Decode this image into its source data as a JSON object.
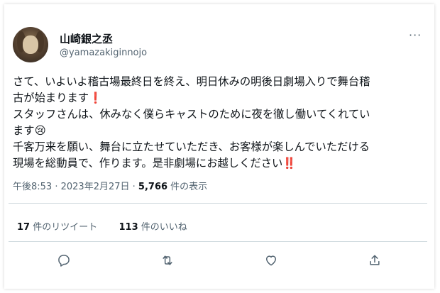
{
  "user": {
    "display_name": "山崎銀之丞",
    "handle": "@yamazakiginnojo"
  },
  "more_label": "···",
  "tweet": {
    "line1": "さて、いよいよ稽古場最終日を終え、明日休みの明後日劇場入りで舞台稽",
    "line2": "古が始まります",
    "line2_emoji": "❗",
    "line3": "スタッフさんは、休みなく僕らキャストのために夜を徹し働いてくれてい",
    "line4": "ます",
    "line4_emoji": "😢",
    "line5": "千客万来を願い、舞台に立たせていただき、お客様が楽しんでいただける",
    "line6": "現場を総動員で、作ります。是非劇場にお越しください",
    "line6_emoji": "‼️"
  },
  "meta": {
    "time": "午後8:53",
    "sep": " · ",
    "date": "2023年2月27日",
    "sep2": " · ",
    "views": "5,766",
    "views_label": " 件の表示"
  },
  "stats": {
    "retweets": "17",
    "retweets_label": " 件のリツイート",
    "likes": "113",
    "likes_label": " 件のいいね"
  },
  "icons": [
    "reply-icon",
    "retweet-icon",
    "like-icon",
    "share-icon"
  ],
  "colors": {
    "text": "#0f1419",
    "secondary": "#536471",
    "divider": "#cfd9de",
    "accent_red": "#e0245e"
  }
}
